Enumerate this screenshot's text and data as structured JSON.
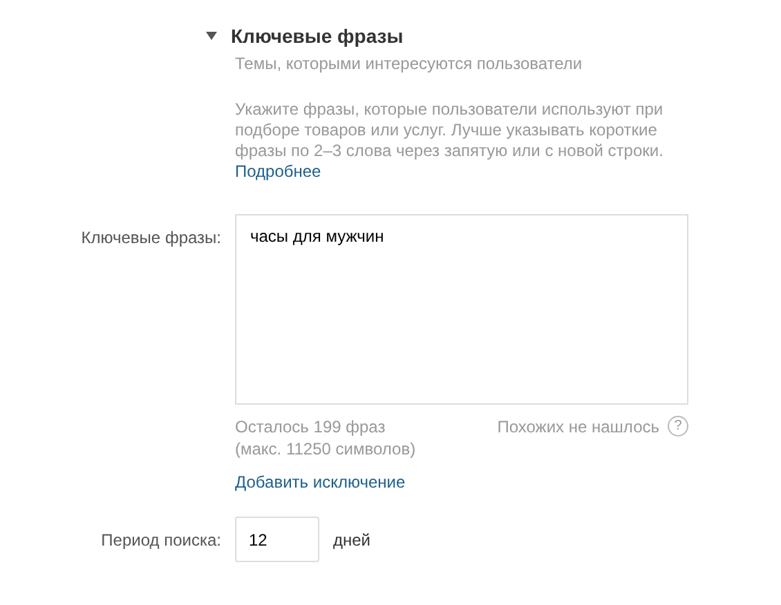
{
  "section": {
    "title": "Ключевые фразы",
    "expanded": true,
    "subtitle": "Темы, которыми интересуются пользователи",
    "hint": "Укажите фразы, которые пользователи используют при подборе товаров или услуг. Лучше указывать короткие фразы по 2–3 слова через запятую или с новой строки.",
    "hint_link": "Подробнее"
  },
  "keywords": {
    "label": "Ключевые фразы:",
    "value": "часы для мужчин",
    "remaining": "Осталось 199 фраз",
    "max": "(макс. 11250 символов)",
    "similar": "Похожих не нашлось",
    "help": "?",
    "add_exclusion": "Добавить исключение"
  },
  "period": {
    "label": "Период поиска:",
    "value": "12",
    "unit": "дней"
  }
}
